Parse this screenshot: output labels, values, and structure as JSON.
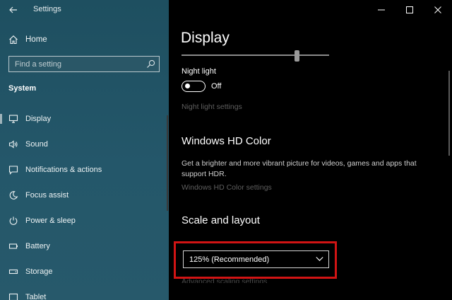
{
  "window": {
    "title": "Settings"
  },
  "sidebar": {
    "home_label": "Home",
    "search_placeholder": "Find a setting",
    "section_title": "System",
    "items": [
      {
        "label": "Display",
        "icon": "monitor-icon",
        "selected": true
      },
      {
        "label": "Sound",
        "icon": "speaker-icon"
      },
      {
        "label": "Notifications & actions",
        "icon": "notification-icon"
      },
      {
        "label": "Focus assist",
        "icon": "moon-icon"
      },
      {
        "label": "Power & sleep",
        "icon": "power-icon"
      },
      {
        "label": "Battery",
        "icon": "battery-icon"
      },
      {
        "label": "Storage",
        "icon": "storage-icon"
      },
      {
        "label": "Tablet",
        "icon": "tablet-icon"
      }
    ]
  },
  "main": {
    "title": "Display",
    "night_light": {
      "label": "Night light",
      "state_label": "Off",
      "link": "Night light settings"
    },
    "hd_color": {
      "title": "Windows HD Color",
      "description": "Get a brighter and more vibrant picture for videos, games and apps that support HDR.",
      "link": "Windows HD Color settings"
    },
    "scale": {
      "title": "Scale and layout",
      "selected_value": "125% (Recommended)",
      "advanced_link": "Advanced scaling settings"
    }
  },
  "colors": {
    "sidebar_bg": "#1f4e5e",
    "main_bg": "#000000",
    "highlight": "#d11414"
  }
}
